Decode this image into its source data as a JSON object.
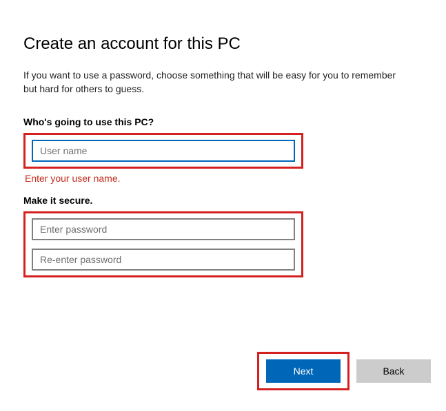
{
  "title": "Create an account for this PC",
  "description": "If you want to use a password, choose something that will be easy for you to remember but hard for others to guess.",
  "username_section": {
    "label": "Who's going to use this PC?",
    "placeholder": "User name",
    "value": "",
    "error": "Enter your user name."
  },
  "password_section": {
    "label": "Make it secure.",
    "password_placeholder": "Enter password",
    "confirm_placeholder": "Re-enter password",
    "password_value": "",
    "confirm_value": ""
  },
  "buttons": {
    "next": "Next",
    "back": "Back"
  },
  "colors": {
    "accent": "#0067b8",
    "error": "#c42b1c",
    "highlight": "#d4201f"
  }
}
